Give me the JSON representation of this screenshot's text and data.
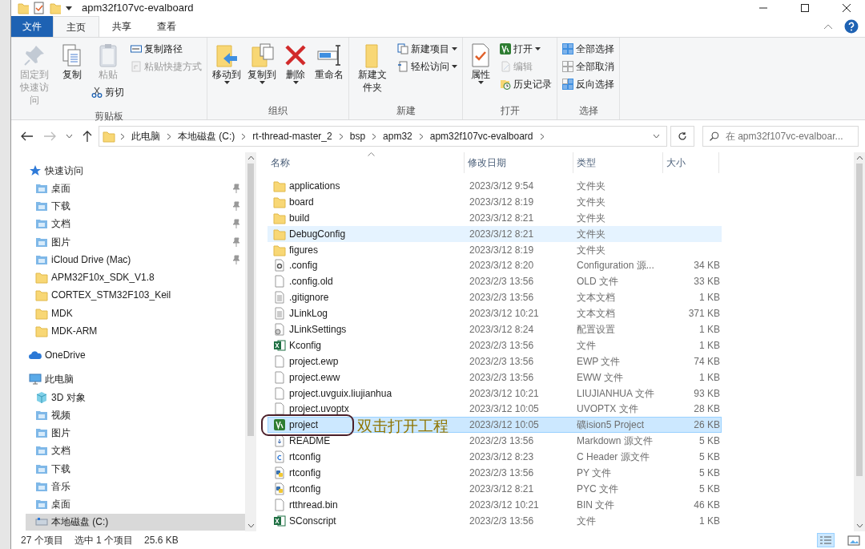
{
  "window": {
    "title": "apm32f107vc-evalboard"
  },
  "tabs": [
    {
      "label": "文件",
      "selected": false,
      "kind": "file"
    },
    {
      "label": "主页",
      "selected": true,
      "kind": "tab"
    },
    {
      "label": "共享",
      "selected": false,
      "kind": "tab"
    },
    {
      "label": "查看",
      "selected": false,
      "kind": "tab"
    }
  ],
  "ribbon": [
    {
      "name": "剪贴板",
      "columns": [
        [
          {
            "label": "固定到快速访问",
            "kind": "large",
            "disabled": true,
            "dropdown": false
          }
        ],
        [
          {
            "label": "复制",
            "kind": "large",
            "disabled": false,
            "dropdown": false
          }
        ],
        [
          {
            "label": "粘贴",
            "kind": "large",
            "disabled": true,
            "dropdown": false
          },
          {
            "label": "剪切",
            "kind": "small",
            "disabled": false,
            "dropdown": false
          }
        ],
        [
          {
            "label": "复制路径",
            "kind": "small",
            "disabled": false,
            "dropdown": false
          },
          {
            "label": "粘贴快捷方式",
            "kind": "small",
            "disabled": true,
            "dropdown": false
          }
        ]
      ]
    },
    {
      "name": "组织",
      "columns": [
        [
          {
            "label": "移动到",
            "kind": "large",
            "disabled": false,
            "dropdown": true
          }
        ],
        [
          {
            "label": "复制到",
            "kind": "large",
            "disabled": false,
            "dropdown": true
          }
        ],
        [
          {
            "label": "删除",
            "kind": "large",
            "disabled": false,
            "dropdown": true
          }
        ],
        [
          {
            "label": "重命名",
            "kind": "large",
            "disabled": false,
            "dropdown": false
          }
        ]
      ]
    },
    {
      "name": "新建",
      "columns": [
        [
          {
            "label": "新建文件夹",
            "kind": "large",
            "disabled": false,
            "dropdown": false
          }
        ],
        [
          {
            "label": "新建项目",
            "kind": "small",
            "disabled": false,
            "dropdown": true
          },
          {
            "label": "轻松访问",
            "kind": "small",
            "disabled": false,
            "dropdown": true
          }
        ]
      ]
    },
    {
      "name": "打开",
      "columns": [
        [
          {
            "label": "属性",
            "kind": "large",
            "disabled": false,
            "dropdown": true
          }
        ],
        [
          {
            "label": "打开",
            "kind": "small",
            "disabled": false,
            "dropdown": true
          },
          {
            "label": "编辑",
            "kind": "small",
            "disabled": true,
            "dropdown": false
          },
          {
            "label": "历史记录",
            "kind": "small",
            "disabled": false,
            "dropdown": false
          }
        ]
      ]
    },
    {
      "name": "选择",
      "columns": [
        [
          {
            "label": "全部选择",
            "kind": "small",
            "disabled": false,
            "dropdown": false
          },
          {
            "label": "全部取消",
            "kind": "small",
            "disabled": false,
            "dropdown": false
          },
          {
            "label": "反向选择",
            "kind": "small",
            "disabled": false,
            "dropdown": false
          }
        ]
      ]
    }
  ],
  "address": {
    "segments": [
      "此电脑",
      "本地磁盘 (C:)",
      "rt-thread-master_2",
      "bsp",
      "apm32",
      "apm32f107vc-evalboard"
    ],
    "forward_disabled": true
  },
  "search": {
    "placeholder": "在 apm32f107vc-evalboar..."
  },
  "sidebar": {
    "items": [
      {
        "label": "快速访问",
        "kind": "star",
        "selected": false,
        "children": [
          {
            "label": "桌面",
            "kind": "library",
            "pinned": true,
            "selected": false
          },
          {
            "label": "下载",
            "kind": "library",
            "pinned": true,
            "selected": false
          },
          {
            "label": "文档",
            "kind": "library",
            "pinned": true,
            "selected": false
          },
          {
            "label": "图片",
            "kind": "library",
            "pinned": true,
            "selected": false
          },
          {
            "label": "iCloud Drive (Mac)",
            "kind": "library",
            "pinned": true,
            "selected": false
          },
          {
            "label": "APM32F10x_SDK_V1.8",
            "kind": "folder",
            "pinned": false,
            "selected": false
          },
          {
            "label": "CORTEX_STM32F103_Keil",
            "kind": "folder",
            "pinned": false,
            "selected": false
          },
          {
            "label": "MDK",
            "kind": "folder",
            "pinned": false,
            "selected": false
          },
          {
            "label": "MDK-ARM",
            "kind": "folder",
            "pinned": false,
            "selected": false
          }
        ]
      },
      {
        "label": "OneDrive",
        "kind": "cloud",
        "selected": false
      },
      {
        "label": "此电脑",
        "kind": "pc",
        "selected": false,
        "children": [
          {
            "label": "3D 对象",
            "kind": "cube",
            "pinned": false,
            "selected": false
          },
          {
            "label": "视频",
            "kind": "library",
            "pinned": false,
            "selected": false
          },
          {
            "label": "图片",
            "kind": "library",
            "pinned": false,
            "selected": false
          },
          {
            "label": "文档",
            "kind": "library",
            "pinned": false,
            "selected": false
          },
          {
            "label": "下载",
            "kind": "library",
            "pinned": false,
            "selected": false
          },
          {
            "label": "音乐",
            "kind": "library",
            "pinned": false,
            "selected": false
          },
          {
            "label": "桌面",
            "kind": "library",
            "pinned": false,
            "selected": false
          },
          {
            "label": "本地磁盘 (C:)",
            "kind": "drive",
            "pinned": false,
            "selected": true
          }
        ]
      }
    ]
  },
  "table": {
    "columns": [
      "名称",
      "修改日期",
      "类型",
      "大小"
    ],
    "rows": [
      {
        "name": "applications",
        "date": "2023/3/12 9:54",
        "type": "文件夹",
        "size": "",
        "kind": "folder",
        "hovered": false,
        "selected": false
      },
      {
        "name": "board",
        "date": "2023/3/12 8:19",
        "type": "文件夹",
        "size": "",
        "kind": "folder",
        "hovered": false,
        "selected": false
      },
      {
        "name": "build",
        "date": "2023/3/12 8:21",
        "type": "文件夹",
        "size": "",
        "kind": "folder",
        "hovered": false,
        "selected": false
      },
      {
        "name": "DebugConfig",
        "date": "2023/3/12 8:21",
        "type": "文件夹",
        "size": "",
        "kind": "folder",
        "hovered": true,
        "selected": false
      },
      {
        "name": "figures",
        "date": "2023/3/12 8:19",
        "type": "文件夹",
        "size": "",
        "kind": "folder",
        "hovered": false,
        "selected": false
      },
      {
        "name": ".config",
        "date": "2023/3/12 8:20",
        "type": "Configuration 源...",
        "size": "34 KB",
        "kind": "config",
        "hovered": false,
        "selected": false
      },
      {
        "name": ".config.old",
        "date": "2023/2/3 13:56",
        "type": "OLD 文件",
        "size": "33 KB",
        "kind": "file",
        "hovered": false,
        "selected": false
      },
      {
        "name": ".gitignore",
        "date": "2023/2/3 13:56",
        "type": "文本文档",
        "size": "1 KB",
        "kind": "text",
        "hovered": false,
        "selected": false
      },
      {
        "name": "JLinkLog",
        "date": "2023/3/12 10:21",
        "type": "文本文档",
        "size": "371 KB",
        "kind": "text",
        "hovered": false,
        "selected": false
      },
      {
        "name": "JLinkSettings",
        "date": "2023/3/12 8:24",
        "type": "配置设置",
        "size": "1 KB",
        "kind": "settings",
        "hovered": false,
        "selected": false
      },
      {
        "name": "Kconfig",
        "date": "2023/2/3 13:56",
        "type": "文件",
        "size": "1 KB",
        "kind": "sheet",
        "hovered": false,
        "selected": false
      },
      {
        "name": "project.ewp",
        "date": "2023/2/3 13:56",
        "type": "EWP 文件",
        "size": "74 KB",
        "kind": "file",
        "hovered": false,
        "selected": false
      },
      {
        "name": "project.eww",
        "date": "2023/2/3 13:56",
        "type": "EWW 文件",
        "size": "1 KB",
        "kind": "file",
        "hovered": false,
        "selected": false
      },
      {
        "name": "project.uvguix.liujianhua",
        "date": "2023/3/12 10:21",
        "type": "LIUJIANHUA 文件",
        "size": "93 KB",
        "kind": "file",
        "hovered": false,
        "selected": false
      },
      {
        "name": "project.uvoptx",
        "date": "2023/3/12 10:05",
        "type": "UVOPTX 文件",
        "size": "28 KB",
        "kind": "file",
        "hovered": false,
        "selected": false
      },
      {
        "name": "project",
        "date": "2023/3/12 10:05",
        "type": "礦ision5 Project",
        "size": "26 KB",
        "kind": "uvision",
        "hovered": false,
        "selected": true
      },
      {
        "name": "README",
        "date": "2023/2/3 13:56",
        "type": "Markdown 源文件",
        "size": "5 KB",
        "kind": "markdown",
        "hovered": false,
        "selected": false
      },
      {
        "name": "rtconfig",
        "date": "2023/3/12 8:23",
        "type": "C Header 源文件",
        "size": "5 KB",
        "kind": "cheader",
        "hovered": false,
        "selected": false
      },
      {
        "name": "rtconfig",
        "date": "2023/2/3 13:56",
        "type": "PY 文件",
        "size": "5 KB",
        "kind": "python",
        "hovered": false,
        "selected": false
      },
      {
        "name": "rtconfig",
        "date": "2023/3/12 8:21",
        "type": "PYC 文件",
        "size": "5 KB",
        "kind": "python",
        "hovered": false,
        "selected": false
      },
      {
        "name": "rtthread.bin",
        "date": "2023/3/12 10:21",
        "type": "BIN 文件",
        "size": "46 KB",
        "kind": "file",
        "hovered": false,
        "selected": false
      },
      {
        "name": "SConscript",
        "date": "2023/2/3 13:56",
        "type": "文件",
        "size": "1 KB",
        "kind": "sheet",
        "hovered": false,
        "selected": false
      }
    ]
  },
  "annotation": {
    "text": "双击打开工程"
  },
  "status_bar": {
    "count": "27 个项目",
    "selection": "选中 1 个项目",
    "size": "25.6 KB",
    "views": [
      {
        "kind": "details",
        "selected": true
      },
      {
        "kind": "thumbnails",
        "selected": false
      }
    ]
  }
}
